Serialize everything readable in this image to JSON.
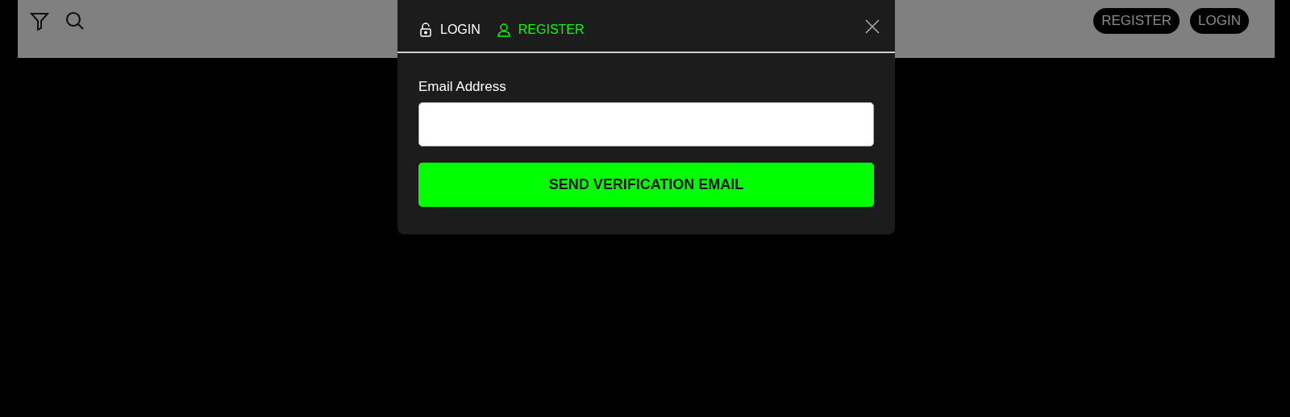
{
  "header": {
    "buttons": [
      {
        "label": "REGISTER"
      },
      {
        "label": "LOGIN"
      }
    ]
  },
  "modal": {
    "tabs": [
      {
        "label": "LOGIN",
        "kind": "lock",
        "selected": false
      },
      {
        "label": "REGISTER",
        "kind": "user",
        "selected": true
      }
    ],
    "email_label": "Email Address",
    "submit": "SEND VERIFICATION EMAIL"
  }
}
